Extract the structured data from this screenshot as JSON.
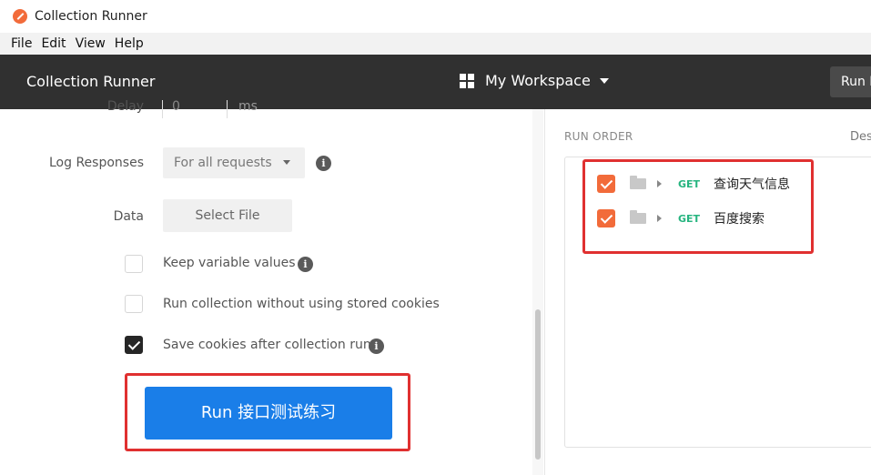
{
  "window": {
    "title": "Collection Runner"
  },
  "menu": [
    "File",
    "Edit",
    "View",
    "Help"
  ],
  "header": {
    "app_title": "Collection Runner",
    "workspace": "My Workspace",
    "run_button": "Run I"
  },
  "settings": {
    "delay_label": "Delay",
    "delay_value": "0",
    "delay_unit": "ms",
    "log_label": "Log Responses",
    "log_value": "For all requests",
    "data_label": "Data",
    "select_file": "Select File",
    "options": [
      {
        "label": "Keep variable values",
        "checked": false,
        "info": true
      },
      {
        "label": "Run collection without using stored cookies",
        "checked": false,
        "info": false
      },
      {
        "label": "Save cookies after collection run",
        "checked": true,
        "info": true
      }
    ],
    "run_button": "Run 接口测试练习"
  },
  "run_order": {
    "title": "RUN ORDER",
    "column": "Des",
    "requests": [
      {
        "method": "GET",
        "name": "查询天气信息",
        "checked": true
      },
      {
        "method": "GET",
        "name": "百度搜索",
        "checked": true
      }
    ]
  },
  "colors": {
    "accent": "#f26b3a",
    "primary_button": "#1a7ee8",
    "header_bg": "#303030",
    "highlight": "#e03030",
    "get_method": "#26b47f"
  }
}
